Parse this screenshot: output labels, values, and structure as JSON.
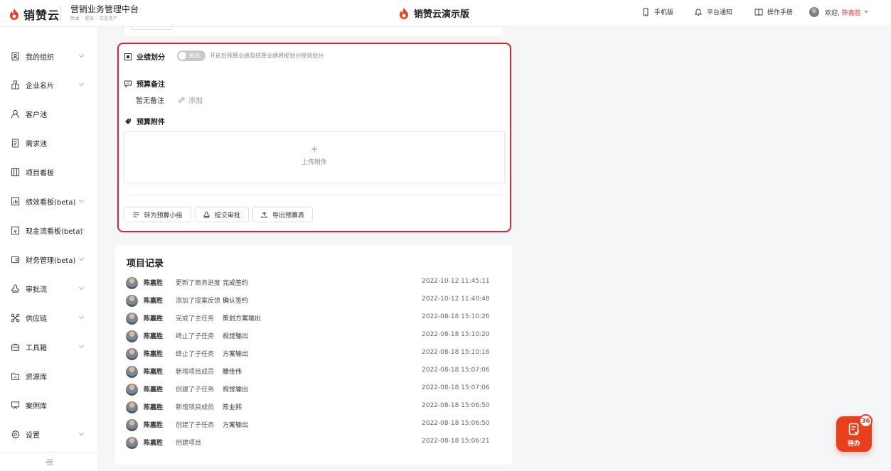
{
  "header": {
    "brand": "销赞云",
    "system_title": "营销业务管理中台",
    "system_sub": "降本 · 提效 · 沉淀资产",
    "center_title": "销赞云演示版",
    "mobile": "手机版",
    "notify": "平台通知",
    "manual": "操作手册",
    "welcome": "欢迎,",
    "user": "陈嘉胜"
  },
  "sidebar": {
    "items": [
      {
        "label": "我的组织",
        "icon": "org-icon",
        "has_chevron": true
      },
      {
        "label": "企业名片",
        "icon": "building-icon",
        "has_chevron": true
      },
      {
        "label": "客户池",
        "icon": "user-icon",
        "has_chevron": false
      },
      {
        "label": "需求池",
        "icon": "document-icon",
        "has_chevron": false
      },
      {
        "label": "项目看板",
        "icon": "kanban-icon",
        "has_chevron": false
      },
      {
        "label": "绩效看板(beta)",
        "icon": "chart-icon",
        "has_chevron": true
      },
      {
        "label": "现金流看板(beta)",
        "icon": "yuan-icon",
        "has_chevron": true
      },
      {
        "label": "财务管理(beta)",
        "icon": "wallet-icon",
        "has_chevron": true
      },
      {
        "label": "审批流",
        "icon": "stamp-icon",
        "has_chevron": true
      },
      {
        "label": "供应链",
        "icon": "network-icon",
        "has_chevron": true
      },
      {
        "label": "工具箱",
        "icon": "toolbox-icon",
        "has_chevron": true
      },
      {
        "label": "资源库",
        "icon": "folder-icon",
        "has_chevron": false
      },
      {
        "label": "案例库",
        "icon": "presentation-icon",
        "has_chevron": false
      },
      {
        "label": "设置",
        "icon": "gear-icon",
        "has_chevron": true
      }
    ]
  },
  "budget": {
    "perf_title": "业绩划分",
    "toggle_label": "关闭",
    "toggle_desc": "开启后预算业绩及结算业绩将按划分规则划分",
    "note_title": "预算备注",
    "note_value": "暂无备注",
    "note_add": "添加",
    "attach_title": "预算附件",
    "upload_plus": "+",
    "upload_label": "上传附件",
    "buttons": {
      "group": "转为预算小组",
      "submit": "提交审批",
      "export": "导出预算表"
    }
  },
  "records": {
    "title": "项目记录",
    "rows": [
      {
        "name": "陈嘉胜",
        "action": "更新了商务进度",
        "target": "完成签约",
        "time": "2022-10-12 11:45:11"
      },
      {
        "name": "陈嘉胜",
        "action": "添加了提案反馈",
        "target": "确认签约",
        "time": "2022-10-12 11:40:48"
      },
      {
        "name": "陈嘉胜",
        "action": "完成了主任务",
        "target": "策划方案输出",
        "time": "2022-08-18 15:10:26"
      },
      {
        "name": "陈嘉胜",
        "action": "终止了子任务",
        "target": "视觉输出",
        "time": "2022-08-18 15:10:20"
      },
      {
        "name": "陈嘉胜",
        "action": "终止了子任务",
        "target": "方案输出",
        "time": "2022-08-18 15:10:16"
      },
      {
        "name": "陈嘉胜",
        "action": "新增项目成员",
        "target": "滕佳伟",
        "time": "2022-08-18 15:07:06"
      },
      {
        "name": "陈嘉胜",
        "action": "创建了子任务",
        "target": "视觉输出",
        "time": "2022-08-18 15:07:06"
      },
      {
        "name": "陈嘉胜",
        "action": "新增项目成员",
        "target": "陈业熙",
        "time": "2022-08-18 15:06:50"
      },
      {
        "name": "陈嘉胜",
        "action": "创建了子任务",
        "target": "方案输出",
        "time": "2022-08-18 15:06:50"
      },
      {
        "name": "陈嘉胜",
        "action": "创建项目",
        "target": "",
        "time": "2022-08-18 15:06:21"
      }
    ]
  },
  "todo": {
    "label": "待办",
    "count": "36"
  },
  "colors": {
    "brand": "#e8401c",
    "highlight": "#d9232d",
    "accent_red": "#e23b3b"
  }
}
